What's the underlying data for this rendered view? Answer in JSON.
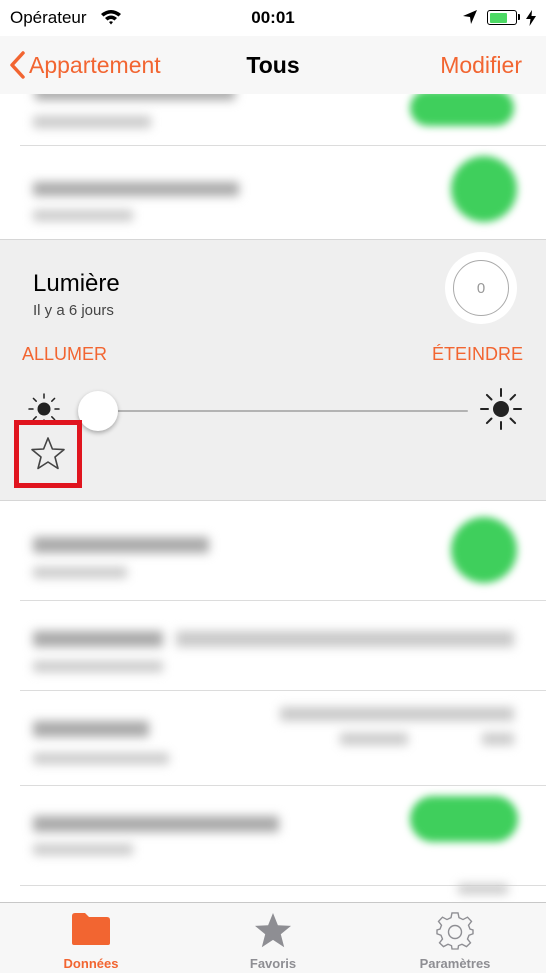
{
  "status_bar": {
    "carrier": "Opérateur",
    "time": "00:01"
  },
  "nav": {
    "back_label": "Appartement",
    "title": "Tous",
    "edit_label": "Modifier"
  },
  "expanded_device": {
    "name": "Lumière",
    "last_update": "Il y a 6 jours",
    "value": "0",
    "on_label": "ALLUMER",
    "off_label": "ÉTEINDRE",
    "brightness": 0
  },
  "tabs": [
    {
      "label": "Données",
      "icon": "folder-icon",
      "active": true
    },
    {
      "label": "Favoris",
      "icon": "star-icon",
      "active": false
    },
    {
      "label": "Paramètres",
      "icon": "gear-icon",
      "active": false
    }
  ],
  "colors": {
    "accent": "#f26531",
    "status_green": "#3fcf5c",
    "highlight_red": "#e0141e"
  }
}
